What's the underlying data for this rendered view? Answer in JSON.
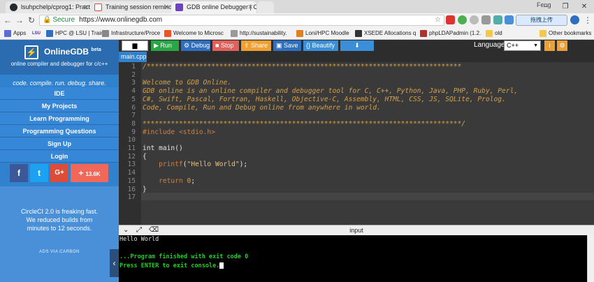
{
  "browser": {
    "tabs": [
      {
        "title": "lsuhpchelp/cprog1: Pract",
        "icon_color": "#24292e"
      },
      {
        "title": "Training session reminde",
        "icon_color": "#d44638"
      },
      {
        "title": "GDB online Debugger | C",
        "icon_color": "#6f42c1"
      }
    ],
    "user": "Feng",
    "url_secure": "Secure",
    "url": "https://www.onlinegdb.com",
    "cloud_button": "拖拽上传",
    "bookmarks": [
      {
        "label": "Apps",
        "color": "#5b6bd8"
      },
      {
        "label": "LSU",
        "color": "#4b2c83"
      },
      {
        "label": "HPC @ LSU | Trainin",
        "color": "#2f6fbf"
      },
      {
        "label": "Infrastructure/Proce",
        "color": "#888888"
      },
      {
        "label": "Welcome to Microsc",
        "color": "#f25022"
      },
      {
        "label": "http://sustainability.",
        "color": "#999999"
      },
      {
        "label": "Loni/HPC Moodle",
        "color": "#e08020"
      },
      {
        "label": "XSEDE Allocations q",
        "color": "#333333"
      },
      {
        "label": "phpLDAPadmin (1.2.",
        "color": "#b03030"
      },
      {
        "label": "old",
        "color": "#f2c94c"
      },
      {
        "label": "Other bookmarks",
        "color": "#f2c94c"
      }
    ]
  },
  "sidebar": {
    "brand": "OnlineGDB",
    "brand_sup": "beta",
    "tagline": "online compiler and debugger for c/c++",
    "motto": "code. compile. run. debug. share.",
    "menu": [
      "IDE",
      "My Projects",
      "Learn Programming",
      "Programming Questions",
      "Sign Up",
      "Login"
    ],
    "share": {
      "facebook": "f",
      "twitter": "t",
      "google": "G+",
      "count": "13.6K"
    },
    "ad": {
      "text": "CircleCI 2.0 is freaking fast. We reduced builds from minutes to 12 seconds.",
      "via": "ADS VIA CARBON"
    }
  },
  "toolbar": {
    "run": "Run",
    "debug": "Debug",
    "stop": "Stop",
    "share": "Share",
    "save": "Save",
    "beautify": "{} Beautify",
    "language_label": "Language",
    "language_value": "C++"
  },
  "file_tab": "main.cpp",
  "code_lines": [
    "/******************************************************************************",
    "",
    "Welcome to GDB Online.",
    "GDB online is an online compiler and debugger tool for C, C++, Python, Java, PHP, Ruby, Perl,",
    "C#, Swift, Pascal, Fortran, Haskell, Objective-C, Assembly, HTML, CSS, JS, SQLite, Prolog.",
    "Code, Compile, Run and Debug online from anywhere in world.",
    "",
    "*******************************************************************************/",
    "#include <stdio.h>",
    "",
    "int main()",
    "{",
    "    printf(\"Hello World\");",
    "",
    "    return 0;",
    "}",
    ""
  ],
  "io_title": "input",
  "console_lines": [
    "Hello World",
    "",
    "...Program finished with exit code 0",
    "Press ENTER to exit console."
  ],
  "colors": {
    "sidebar": "#3182ce",
    "run": "#28a745",
    "debug": "#2f6fbf",
    "stop": "#e0605a",
    "share": "#f0a030",
    "save": "#2f6fbf",
    "beautify": "#3a8fd8",
    "console_text": "#e6e6e6",
    "console_green": "#20d020"
  }
}
